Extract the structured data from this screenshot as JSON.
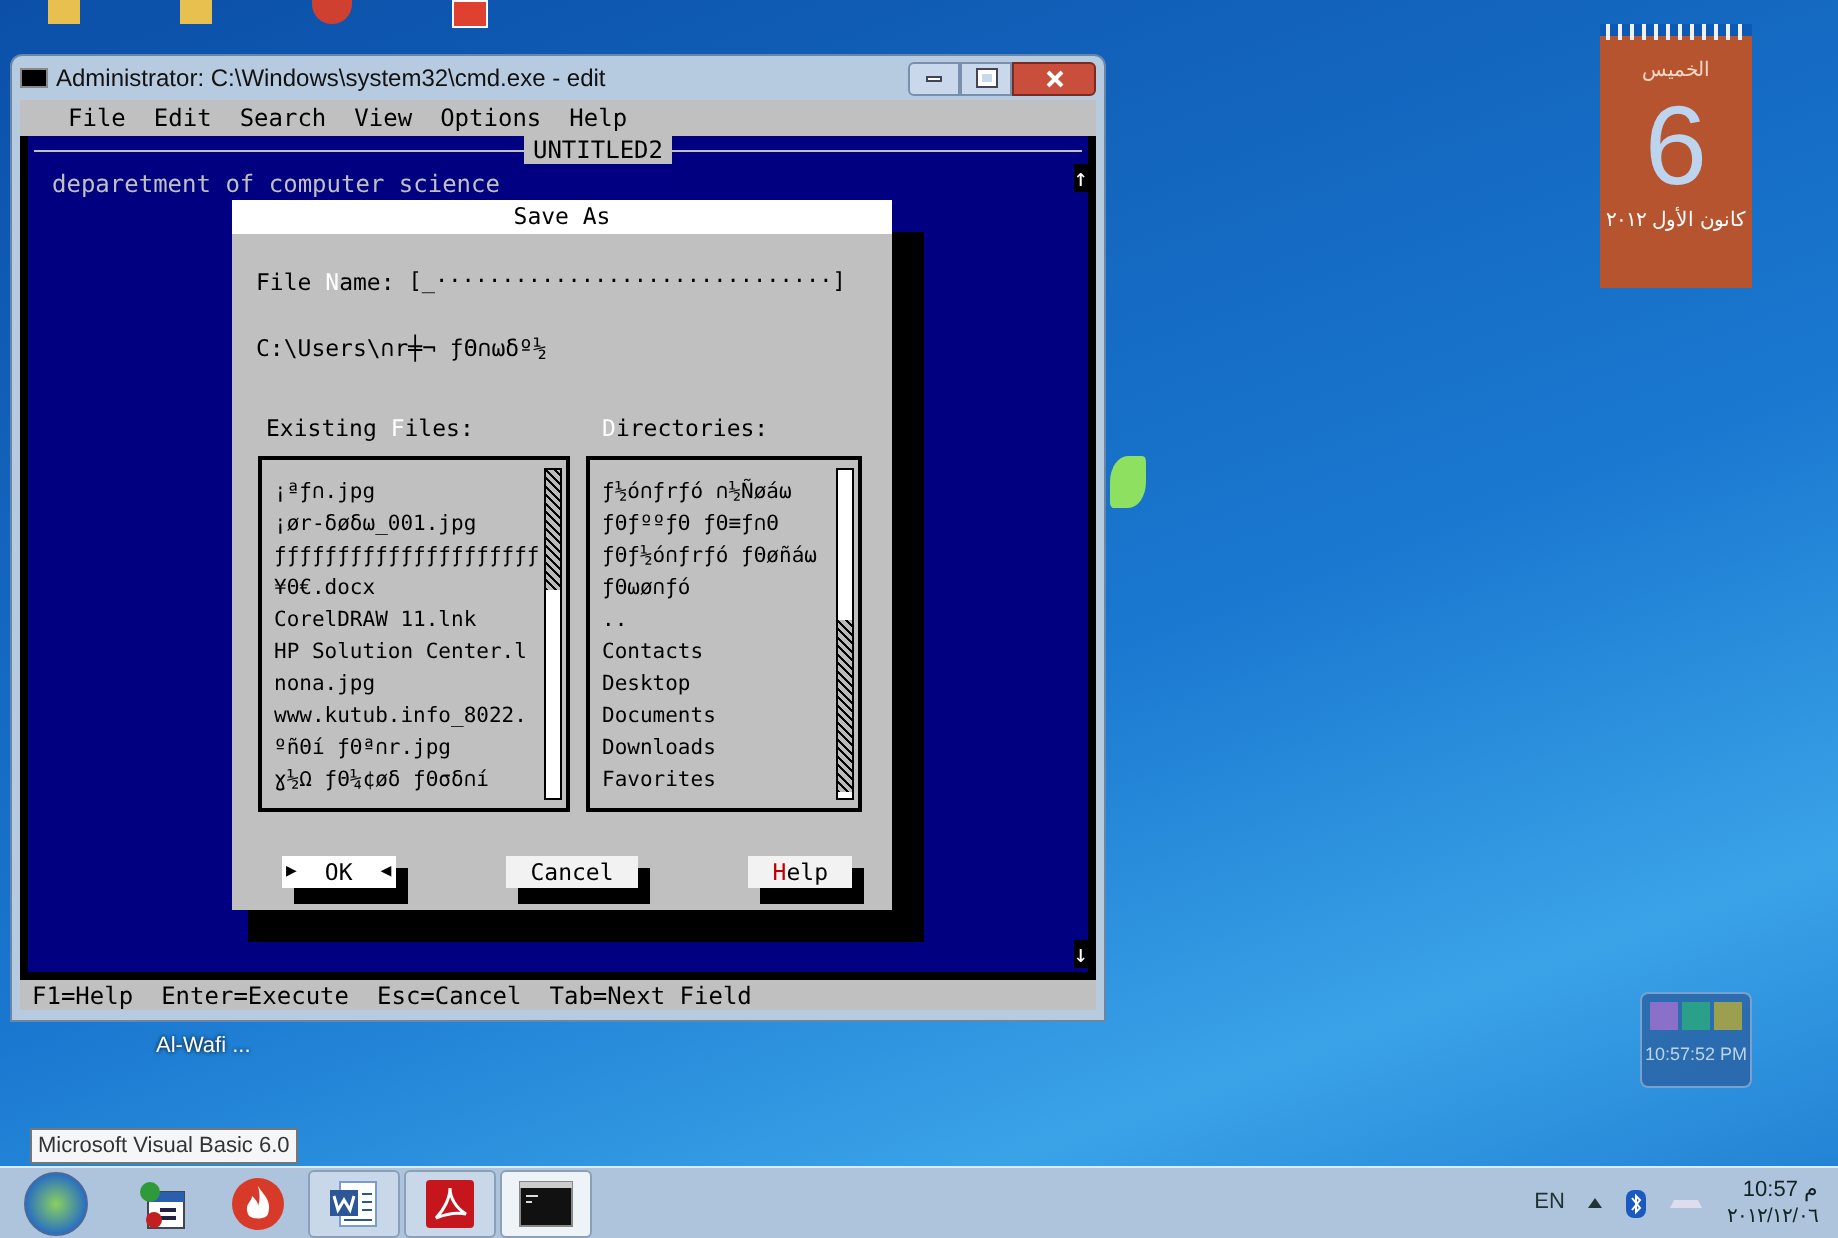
{
  "cmd_window": {
    "title": "Administrator: C:\\Windows\\system32\\cmd.exe - edit",
    "menu": [
      "File",
      "Edit",
      "Search",
      "View",
      "Options",
      "Help"
    ],
    "document_title": "UNTITLED2",
    "text_lines": [
      "deparetment of computer science"
    ],
    "scroll_up": "↑",
    "scroll_down": "↓",
    "status_bar": [
      "F1=Help",
      "Enter=Execute",
      "Esc=Cancel",
      "Tab=Next Field"
    ]
  },
  "save_as_dialog": {
    "title": "Save As",
    "file_name_label": {
      "before": "File ",
      "hotkey": "N",
      "after": "ame:"
    },
    "file_name_value": "[_······························]",
    "path": "C:\\Users\\∩r╪¬ ƒΘ∩ωδº½",
    "existing_files": {
      "label": {
        "before": "Existing ",
        "hotkey": "F",
        "after": "iles:"
      },
      "items": [
        "¡ªƒ∩.jpg",
        "¡ør-δøδω_001.jpg",
        "ƒƒƒƒƒƒƒƒƒƒƒƒƒƒƒƒƒƒƒƒƒ",
        "¥Θ€.docx",
        "CorelDRAW 11.lnk",
        "HP Solution Center.l",
        "nona.jpg",
        "www.kutub.info_8022.",
        "ºñΘí ƒΘª∩r.jpg",
        "ɣ½Ω ƒΘ¼¢øδ ƒΘσδ∩í"
      ]
    },
    "directories": {
      "label": {
        "hotkey": "D",
        "after": "irectories:"
      },
      "items": [
        "ƒ½ó∩ƒrƒó  ∩½Ñøáω",
        "ƒΘƒººƒΘ ƒΘ≡ƒ∩Θ",
        "ƒΘƒ½ó∩ƒrƒó ƒΘøñáω",
        "ƒΘωø∩ƒó",
        "..",
        "Contacts",
        "Desktop",
        "Documents",
        "Downloads",
        "Favorites"
      ]
    },
    "selection_arrows": [
      "▶",
      "◀"
    ],
    "buttons": [
      {
        "label": "OK",
        "selected": true
      },
      {
        "label": "Cancel",
        "selected": false
      },
      {
        "hotkey": "H",
        "label": "elp",
        "selected": false
      }
    ]
  },
  "desktop": {
    "icon_labels": [
      "Al-Wafi ..."
    ]
  },
  "calendar_gadget": {
    "weekday": "الخميس",
    "day": "6",
    "month_year": "كانون الأول ٢٠١٢"
  },
  "clock_gadget": {
    "time": "10:57:52 PM"
  },
  "tooltip": "Microsoft Visual Basic 6.0",
  "taskbar": {
    "items": [
      {
        "kind": "calendar",
        "open": false,
        "selected": false
      },
      {
        "kind": "flame",
        "open": false,
        "selected": false
      },
      {
        "kind": "word",
        "open": true,
        "selected": false
      },
      {
        "kind": "pdf",
        "open": true,
        "selected": false
      },
      {
        "kind": "console",
        "open": true,
        "selected": true
      }
    ],
    "tray": {
      "language": "EN",
      "time": "10:57 م",
      "date": "٢٠١٢/١٢/٠٦"
    }
  }
}
